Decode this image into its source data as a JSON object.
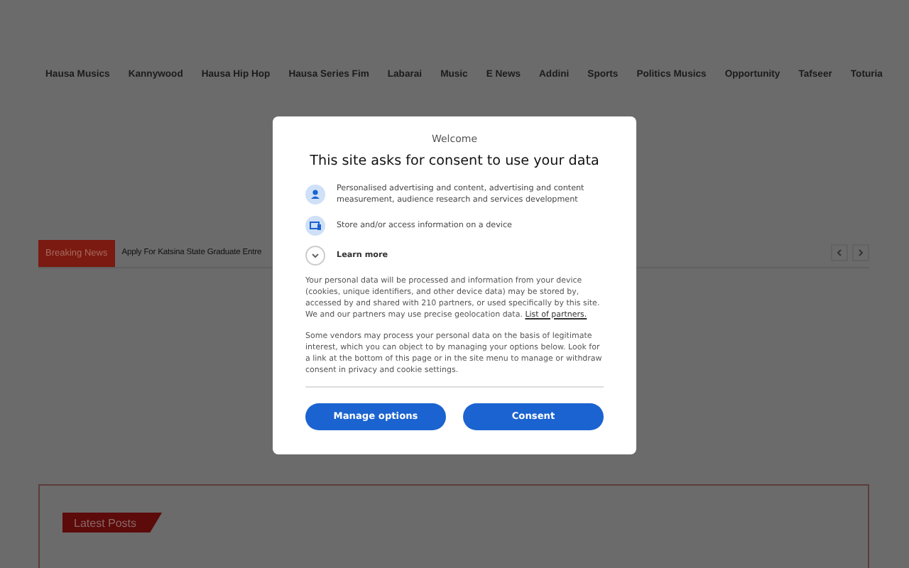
{
  "nav": {
    "items": [
      "Hausa Musics",
      "Kannywood",
      "Hausa Hip Hop",
      "Hausa Series Fim",
      "Labarai",
      "Music",
      "E News",
      "Addini",
      "Sports",
      "Politics Musics",
      "Opportunity",
      "Tafseer",
      "Toturia"
    ]
  },
  "breaking_news": {
    "label": "Breaking News",
    "headline": "Apply For Katsina State Graduate Entre"
  },
  "latest_posts": {
    "title": "Latest Posts"
  },
  "dialog": {
    "kicker": "Welcome",
    "title": "This site asks for consent to use your data",
    "purposes": [
      {
        "kind": "person",
        "text": "Personalised advertising and content, advertising and content measurement, audience research and services development"
      },
      {
        "kind": "device",
        "text": "Store and/or access information on a device"
      },
      {
        "kind": "expand",
        "text": "Learn more"
      }
    ],
    "paragraphs": [
      {
        "text": "Your personal data will be processed and information from your device (cookies, unique identifiers, and other device data) may be stored by, accessed by and shared with 210 partners, or used specifically by this site. We and our partners may use precise geolocation data.",
        "link": "List of partners."
      },
      {
        "text": "Some vendors may process your personal data on the basis of legitimate interest, which you can object to by managing your options below. Look for a link at the bottom of this page or in the site menu to manage or withdraw consent in privacy and cookie settings."
      }
    ],
    "buttons": [
      "Manage options",
      "Consent"
    ]
  }
}
